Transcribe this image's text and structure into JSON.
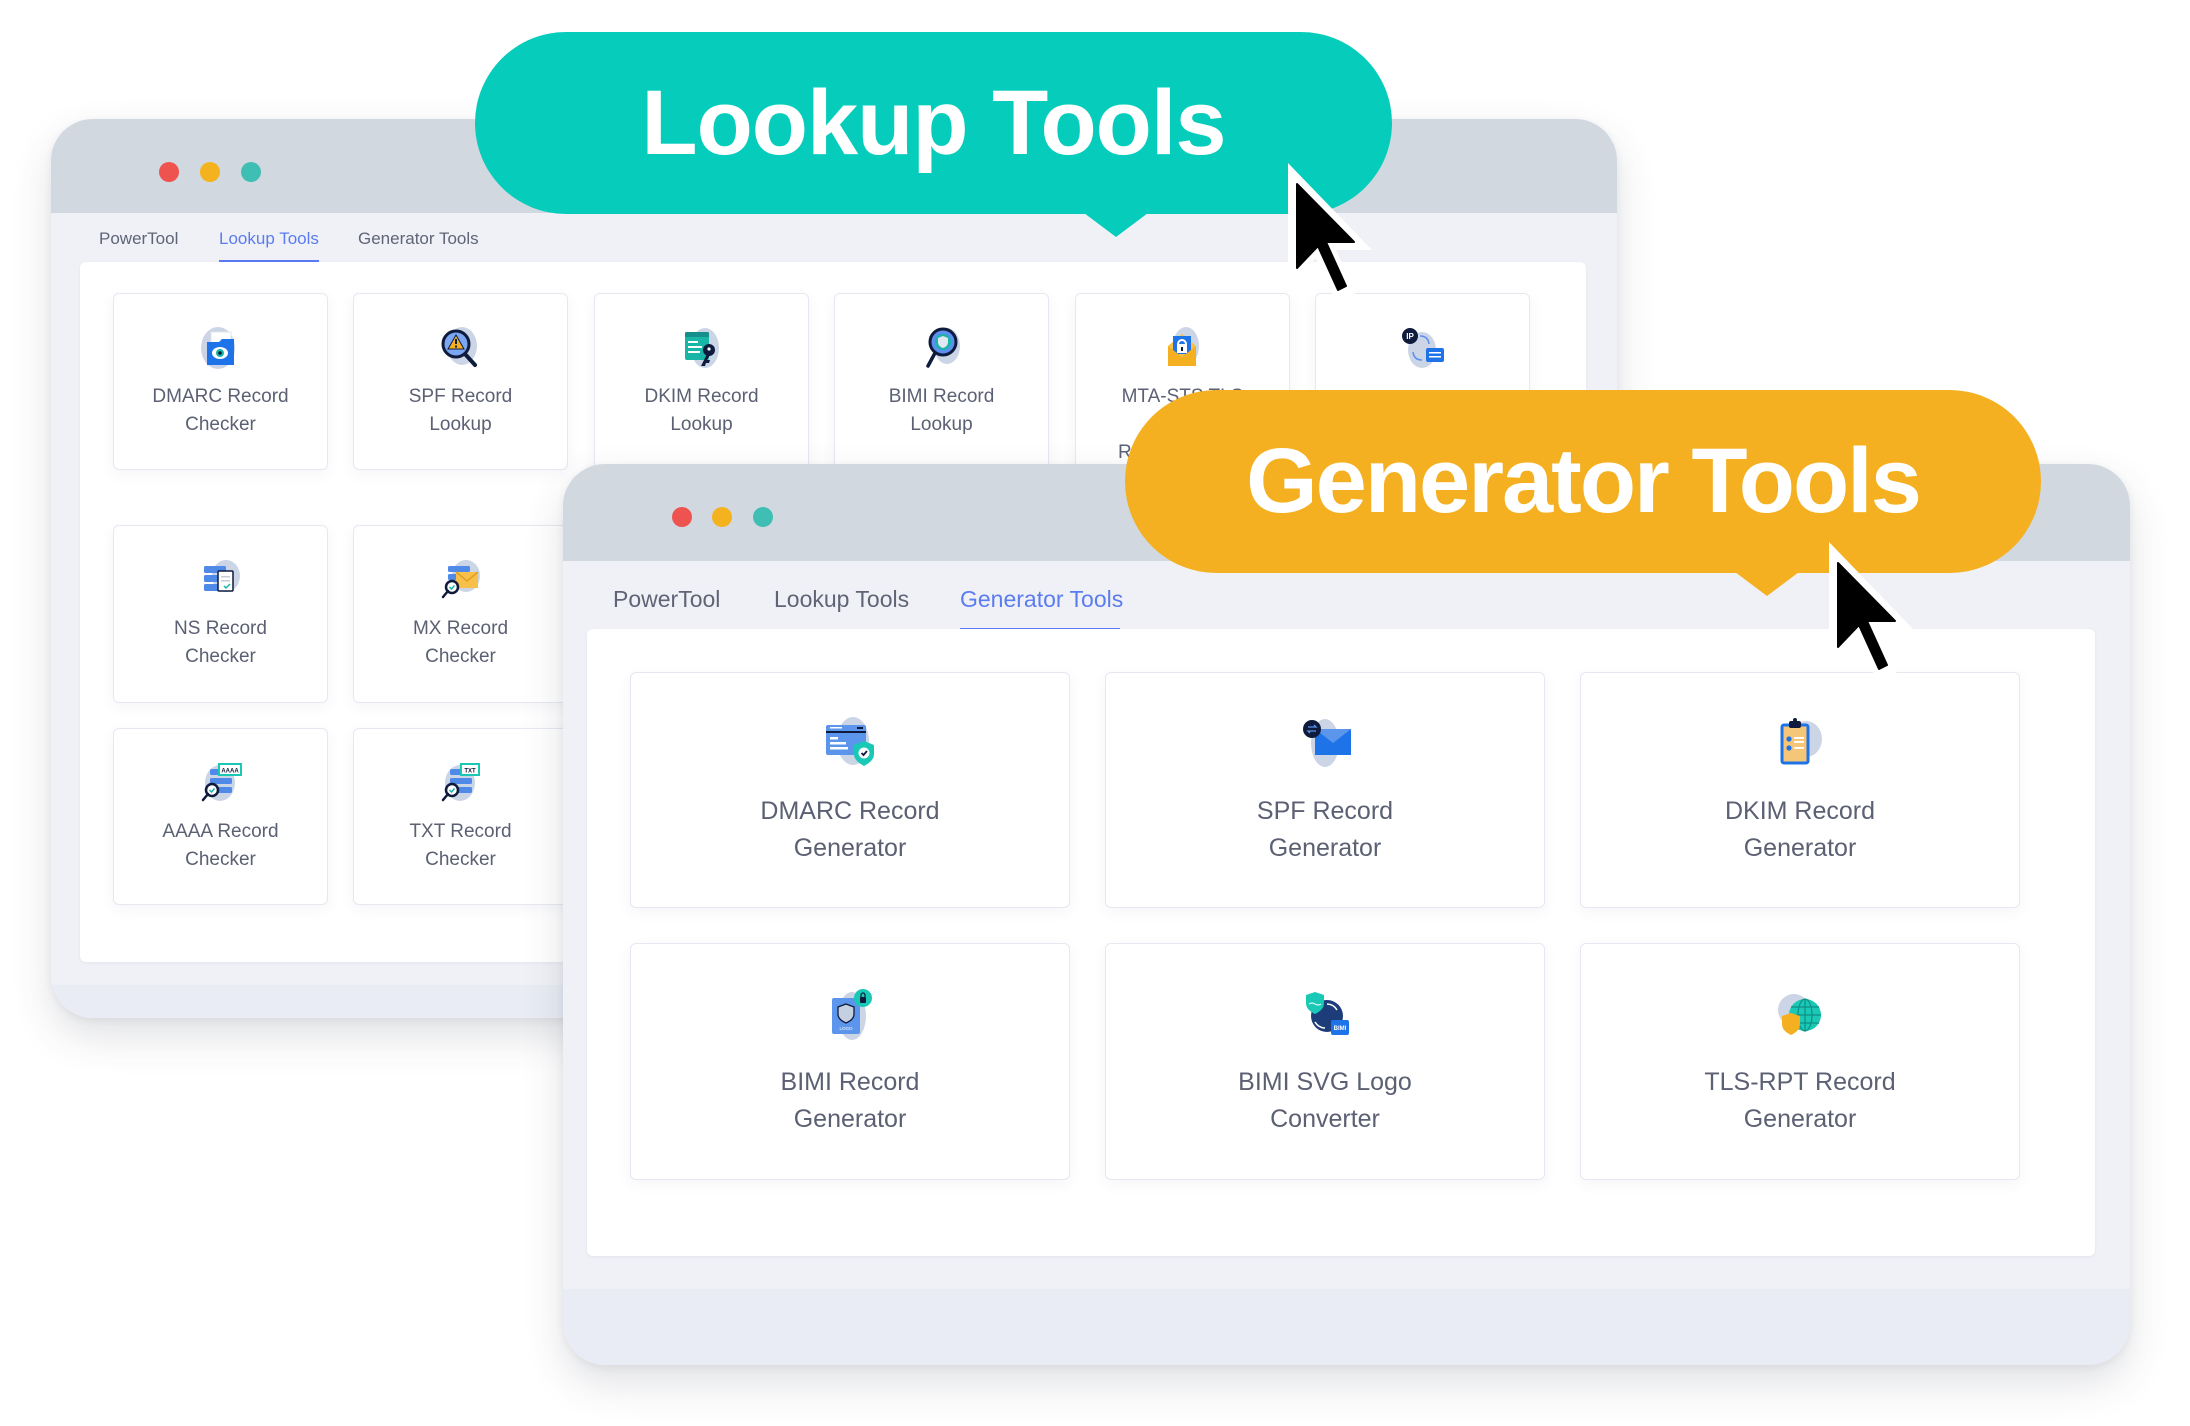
{
  "back_window": {
    "tabs": [
      "PowerTool",
      "Lookup Tools",
      "Generator Tools"
    ],
    "active_tab": "Lookup Tools",
    "cards": [
      {
        "icon": "dmarc-folder-eye-icon",
        "line1": "DMARC Record",
        "line2": "Checker"
      },
      {
        "icon": "spf-magnifier-warning-icon",
        "line1": "SPF Record",
        "line2": "Lookup"
      },
      {
        "icon": "dkim-browser-key-icon",
        "line1": "DKIM Record",
        "line2": "Lookup"
      },
      {
        "icon": "bimi-magnifier-shield-icon",
        "line1": "BIMI Record",
        "line2": "Lookup"
      },
      {
        "icon": "mta-sts-envelope-lock-icon",
        "line1": "MTA-STS TLS",
        "line2": "",
        "line3": "R"
      },
      {
        "icon": "ip-hostname-swap-icon",
        "line1": "",
        "line2": ""
      },
      {
        "icon": "ns-server-document-icon",
        "line1": "NS Record",
        "line2": "Checker"
      },
      {
        "icon": "mx-server-envelope-icon",
        "line1": "MX Record",
        "line2": "Checker"
      },
      {
        "icon": "aaaa-server-magnifier-icon",
        "line1": "AAAA Record",
        "line2": "Checker",
        "badge": "AAAA"
      },
      {
        "icon": "txt-server-magnifier-icon",
        "line1": "TXT Record",
        "line2": "Checker",
        "badge": "TXT"
      }
    ]
  },
  "front_window": {
    "tabs": [
      "PowerTool",
      "Lookup Tools",
      "Generator Tools"
    ],
    "active_tab": "Generator Tools",
    "cards": [
      {
        "icon": "dmarc-browser-shield-icon",
        "line1": "DMARC Record",
        "line2": "Generator"
      },
      {
        "icon": "spf-envelope-swap-icon",
        "line1": "SPF Record",
        "line2": "Generator"
      },
      {
        "icon": "dkim-clipboard-checklist-icon",
        "line1": "DKIM Record",
        "line2": "Generator"
      },
      {
        "icon": "bimi-logo-lock-icon",
        "line1": "BIMI Record",
        "line2": "Generator",
        "badge": "LOGO"
      },
      {
        "icon": "bimi-svg-convert-icon",
        "line1": "BIMI SVG Logo",
        "line2": "Converter",
        "badge": "BIMI"
      },
      {
        "icon": "tls-rpt-globe-shield-icon",
        "line1": "TLS-RPT Record",
        "line2": "Generator"
      }
    ]
  },
  "callouts": {
    "lookup": {
      "label": "Lookup Tools",
      "color": "#06cdbb"
    },
    "generator": {
      "label": "Generator Tools",
      "color": "#f4b020"
    }
  },
  "colors": {
    "accent": "#5b7cf0",
    "window_dot_red": "#ef5350",
    "window_dot_yellow": "#f5b21f",
    "window_dot_teal": "#3fbfb4"
  }
}
